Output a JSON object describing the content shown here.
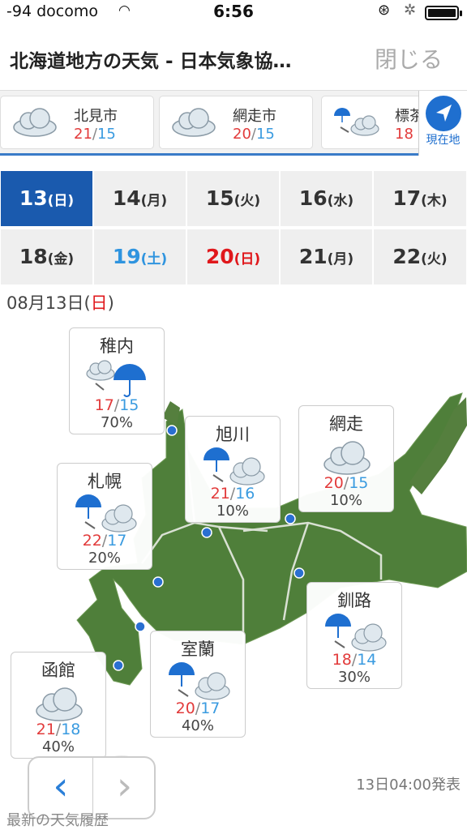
{
  "status_bar": {
    "carrier": "-94 docomo",
    "time": "6:56"
  },
  "header": {
    "title": "北海道地方の天気 - 日本気象協…",
    "close_label": "閉じる"
  },
  "cities": [
    {
      "name": "北見市",
      "hi": "21",
      "lo": "15",
      "icon": "cloud-icon"
    },
    {
      "name": "網走市",
      "hi": "20",
      "lo": "15",
      "icon": "cloud-icon"
    },
    {
      "name": "標茶",
      "hi": "18",
      "lo": "",
      "icon": "rain-then-cloud-icon"
    }
  ],
  "location_button": {
    "label": "現在地"
  },
  "temp_separator": "/",
  "dates": [
    {
      "day": "13",
      "dow": "(日)",
      "state": "active"
    },
    {
      "day": "14",
      "dow": "(月)",
      "state": ""
    },
    {
      "day": "15",
      "dow": "(火)",
      "state": ""
    },
    {
      "day": "16",
      "dow": "(水)",
      "state": ""
    },
    {
      "day": "17",
      "dow": "(木)",
      "state": ""
    },
    {
      "day": "18",
      "dow": "(金)",
      "state": ""
    },
    {
      "day": "19",
      "dow": "(土)",
      "state": "sat"
    },
    {
      "day": "20",
      "dow": "(日)",
      "state": "hol"
    },
    {
      "day": "21",
      "dow": "(月)",
      "state": ""
    },
    {
      "day": "22",
      "dow": "(火)",
      "state": ""
    }
  ],
  "selected_day": {
    "date": "08月13日(",
    "dow": "日",
    "close": ")"
  },
  "regions": [
    {
      "name": "稚内",
      "hi": "17",
      "lo": "15",
      "pop": "70%",
      "icon": "cloud-then-rain-icon"
    },
    {
      "name": "旭川",
      "hi": "21",
      "lo": "16",
      "pop": "10%",
      "icon": "rain-then-cloud-icon"
    },
    {
      "name": "網走",
      "hi": "20",
      "lo": "15",
      "pop": "10%",
      "icon": "cloud-icon"
    },
    {
      "name": "札幌",
      "hi": "22",
      "lo": "17",
      "pop": "20%",
      "icon": "rain-then-cloud-icon"
    },
    {
      "name": "釧路",
      "hi": "18",
      "lo": "14",
      "pop": "30%",
      "icon": "rain-then-cloud-icon"
    },
    {
      "name": "室蘭",
      "hi": "20",
      "lo": "17",
      "pop": "40%",
      "icon": "rain-then-cloud-icon"
    },
    {
      "name": "函館",
      "hi": "21",
      "lo": "18",
      "pop": "40%",
      "icon": "cloud-icon"
    }
  ],
  "issued": "13日04:00発表",
  "pager": {
    "prev": "‹",
    "next": "›"
  },
  "history_link": "最新の天気履歴",
  "colors": {
    "accent": "#1a5aae",
    "hi": "#e23b3b",
    "lo": "#3a9be0",
    "holiday": "#e0181c"
  }
}
